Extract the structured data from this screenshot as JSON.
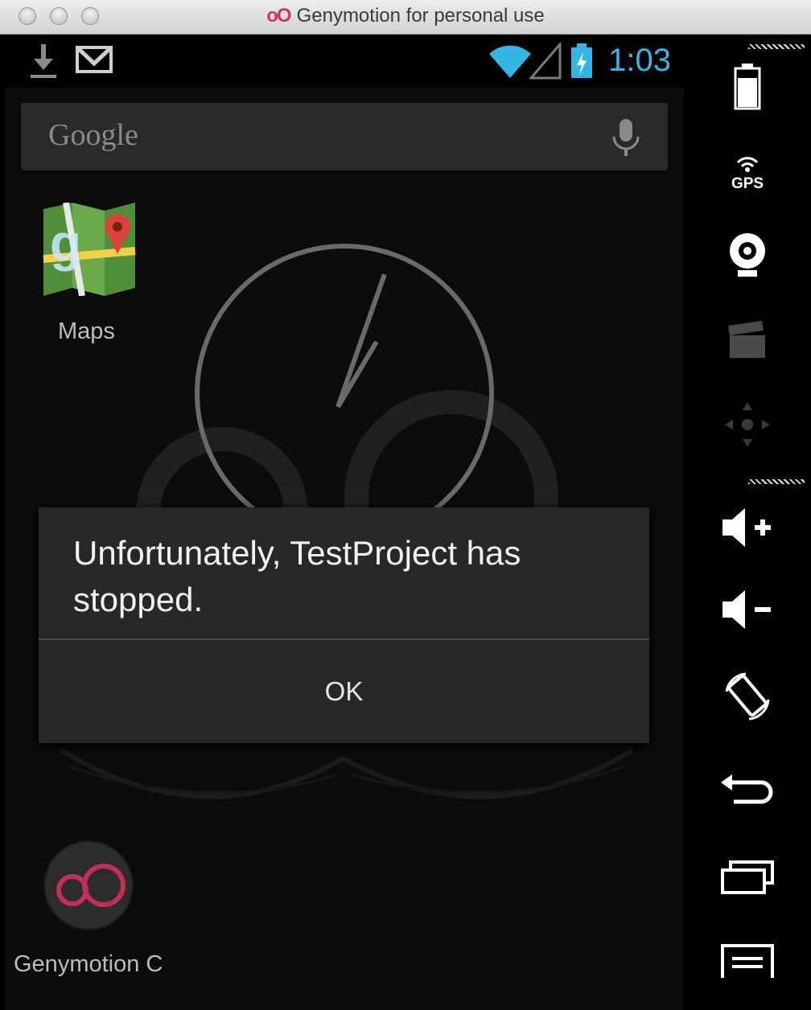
{
  "window": {
    "title": "Genymotion for personal use",
    "logo": "oO"
  },
  "statusbar": {
    "time": "1:03",
    "time_color": "#33b5e5",
    "icons": [
      "download-icon",
      "gmail-icon",
      "wifi-icon",
      "signal-icon",
      "battery-charging-icon"
    ]
  },
  "search": {
    "label": "Google",
    "mic_icon": "microphone-icon"
  },
  "apps": [
    {
      "label": "Maps",
      "icon": "maps-icon"
    },
    {
      "label": "Genymotion C",
      "icon": "genymotion-icon"
    }
  ],
  "dialog": {
    "message": "Unfortunately, TestProject has stopped.",
    "button_label": "OK"
  },
  "sidebar": {
    "gps_label": "GPS",
    "buttons": [
      "battery-icon",
      "gps-icon",
      "webcam-icon",
      "clapperboard-icon",
      "dpad-icon",
      "volume-up-icon",
      "volume-down-icon",
      "rotate-icon",
      "back-icon",
      "recent-apps-icon",
      "menu-icon"
    ]
  },
  "colors": {
    "accent": "#33b5e5",
    "brand": "#d1365f",
    "dialog_bg": "#282828"
  }
}
